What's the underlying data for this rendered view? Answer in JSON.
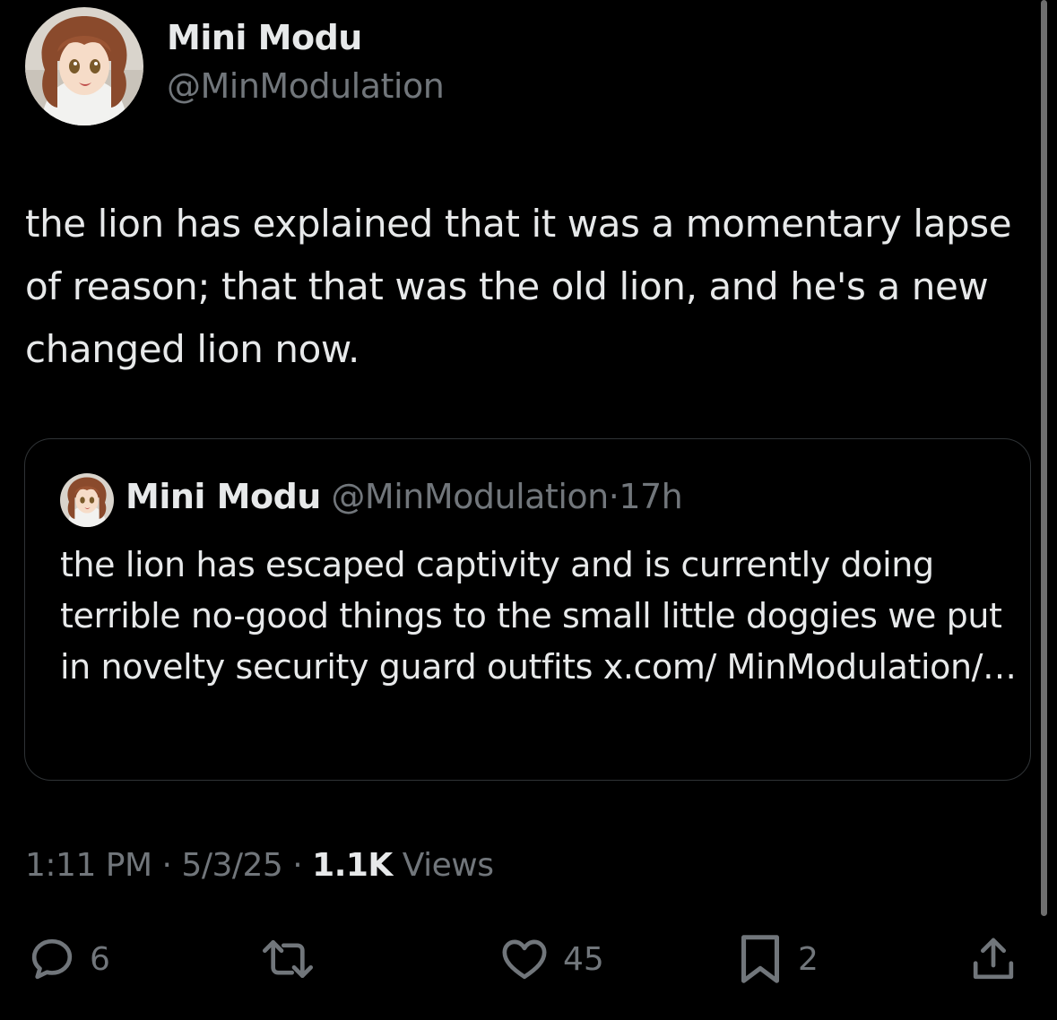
{
  "author": {
    "display_name": "Mini Modu",
    "handle": "@MinModulation",
    "avatar_icon": "anime-girl-avatar"
  },
  "tweet": {
    "text": "the lion has explained that it was a momentary lapse of reason; that that was the old lion, and he's a new changed lion now."
  },
  "quoted_tweet": {
    "display_name": "Mini Modu",
    "handle": "@MinModulation",
    "separator": "·",
    "time": "17h",
    "text": "the lion has escaped captivity and is currently doing terrible no-good things to the small little doggies we put in novelty security guard outfits x.com/ MinModulation/…"
  },
  "meta": {
    "time": "1:11 PM",
    "sep1": "·",
    "date": "5/3/25",
    "sep2": "·",
    "views_count": "1.1K",
    "views_label": "Views"
  },
  "actions": {
    "reply": {
      "icon": "reply-icon",
      "count": "6"
    },
    "repost": {
      "icon": "repost-icon",
      "count": ""
    },
    "like": {
      "icon": "heart-icon",
      "count": "45"
    },
    "bookmark": {
      "icon": "bookmark-icon",
      "count": "2"
    },
    "share": {
      "icon": "share-icon"
    }
  },
  "colors": {
    "background": "#000000",
    "primary_text": "#e7e9ea",
    "secondary_text": "#71767b",
    "border": "#2f3336"
  }
}
